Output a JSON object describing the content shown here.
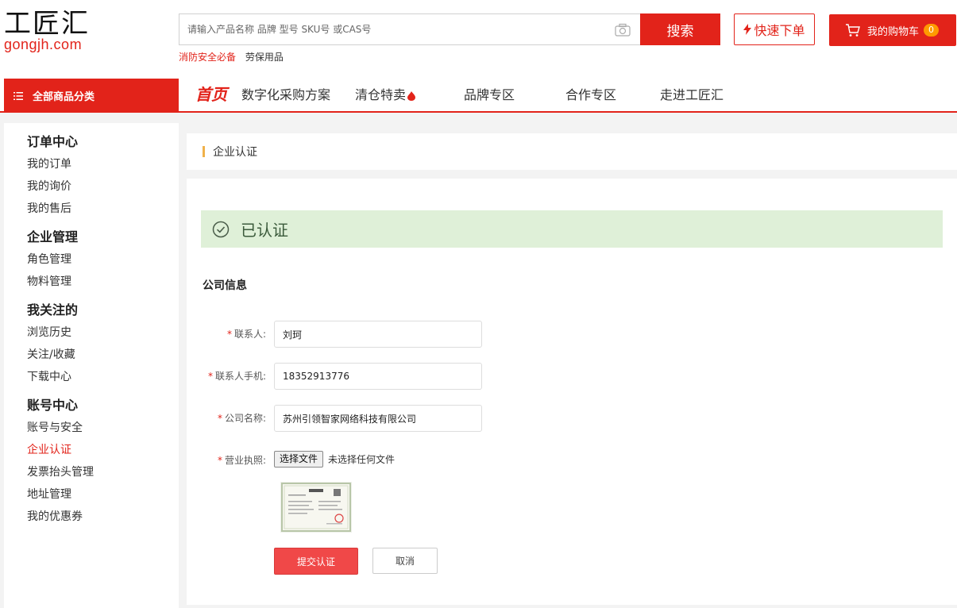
{
  "logo": {
    "cn": "工匠汇",
    "en": "gongjh.com"
  },
  "search": {
    "placeholder": "请输入产品名称 品牌 型号 SKU号 或CAS号",
    "button_label": "搜索",
    "hot_links": [
      "消防安全必备",
      "劳保用品"
    ]
  },
  "quick_order": {
    "label": "快速下单"
  },
  "cart": {
    "label": "我的购物车",
    "count": "0"
  },
  "nav": {
    "all_categories": "全部商品分类",
    "items": [
      "首页",
      "数字化采购方案",
      "清仓特卖",
      "品牌专区",
      "合作专区",
      "走进工匠汇"
    ]
  },
  "sidebar": {
    "groups": [
      {
        "title": "订单中心",
        "items": [
          "我的订单",
          "我的询价",
          "我的售后"
        ]
      },
      {
        "title": "企业管理",
        "items": [
          "角色管理",
          "物料管理"
        ]
      },
      {
        "title": "我关注的",
        "items": [
          "浏览历史",
          "关注/收藏",
          "下载中心"
        ]
      },
      {
        "title": "账号中心",
        "items": [
          "账号与安全",
          "企业认证",
          "发票抬头管理",
          "地址管理",
          "我的优惠券"
        ]
      }
    ],
    "active": "企业认证"
  },
  "breadcrumb": {
    "title": "企业认证"
  },
  "status": {
    "text": "已认证"
  },
  "section": {
    "title": "公司信息"
  },
  "form": {
    "required_mark": "*",
    "contact_label": "联系人:",
    "contact_value": "刘珂",
    "phone_label": "联系人手机:",
    "phone_value": "18352913776",
    "company_label": "公司名称:",
    "company_value": "苏州引领智家网络科技有限公司",
    "license_label": "营业执照:",
    "file_button": "选择文件",
    "file_status": "未选择任何文件",
    "submit_label": "提交认证",
    "cancel_label": "取消"
  },
  "colors": {
    "brand_red": "#e2231a",
    "success_bg": "#dff0d8",
    "accent_bar": "#f0b14a"
  }
}
